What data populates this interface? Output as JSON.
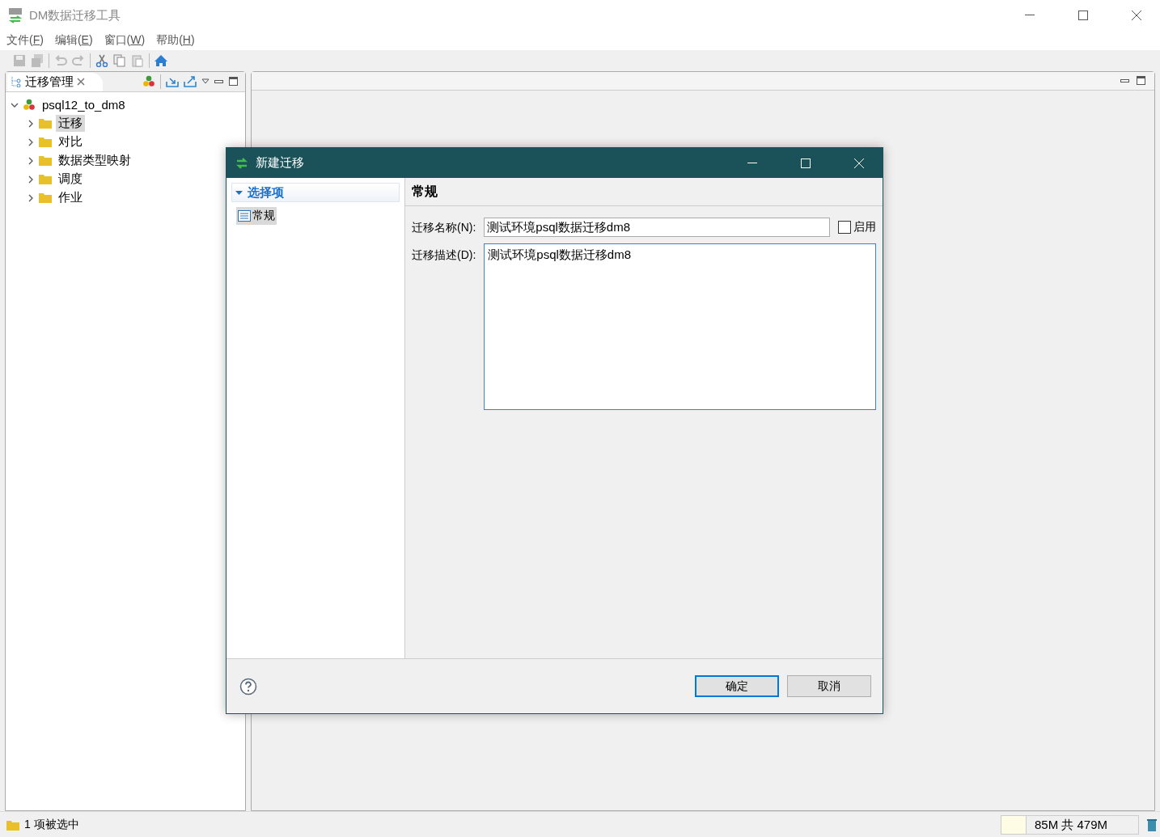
{
  "window": {
    "title": "DM数据迁移工具"
  },
  "menu": [
    {
      "label": "文件(F)"
    },
    {
      "label": "编辑(E)"
    },
    {
      "label": "窗口(W)"
    },
    {
      "label": "帮助(H)"
    }
  ],
  "view": {
    "title": "迁移管理",
    "tree": [
      {
        "label": "psql12_to_dm8",
        "expanded": true,
        "children": [
          {
            "label": "迁移",
            "selected": true
          },
          {
            "label": "对比",
            "selected": false
          },
          {
            "label": "数据类型映射",
            "selected": false
          },
          {
            "label": "调度",
            "selected": false
          },
          {
            "label": "作业",
            "selected": false
          }
        ]
      }
    ]
  },
  "dialog": {
    "title": "新建迁移",
    "nav": {
      "header": "选择项",
      "expanded": true,
      "items": [
        {
          "label": "常规",
          "selected": true
        }
      ]
    },
    "page_title": "常规",
    "name_field": {
      "label": "迁移名称(N):",
      "value": "测试环境psql数据迁移dm8"
    },
    "enable_checkbox": {
      "label": "启用",
      "checked": false
    },
    "description_field": {
      "label": "迁移描述(D):",
      "value": "测试环境psql数据迁移dm8"
    },
    "buttons": [
      {
        "label": "确定",
        "default": true
      },
      {
        "label": "取消",
        "default": false
      }
    ]
  },
  "status_bar": {
    "selection": "1 项被选中",
    "memory": "85M 共 479M"
  }
}
